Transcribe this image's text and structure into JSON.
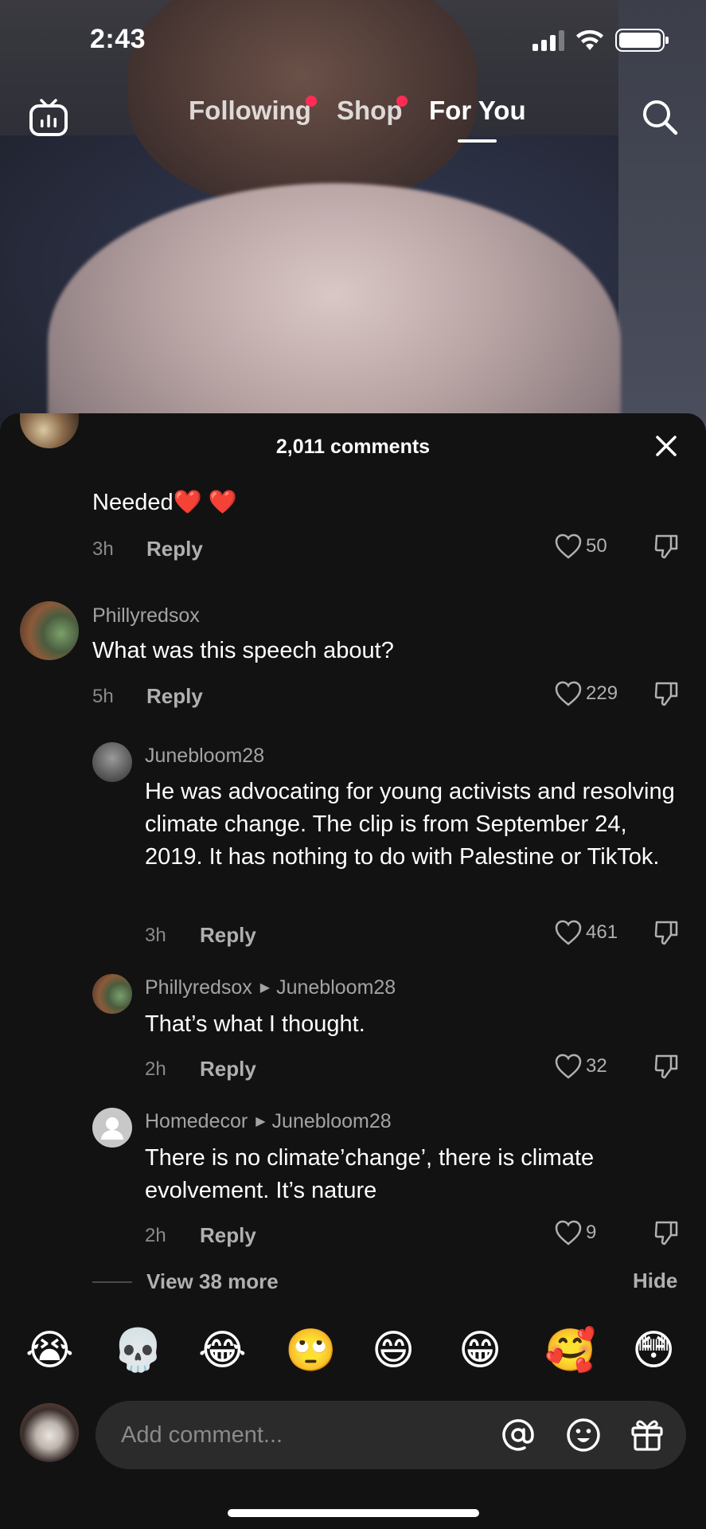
{
  "status_bar": {
    "time": "2:43",
    "icons": [
      "cellular-signal-icon",
      "wifi-icon",
      "battery-icon"
    ]
  },
  "top_nav": {
    "live_icon": "tv-live-icon",
    "tabs": [
      {
        "label": "Following",
        "badge_dot": true,
        "active": false
      },
      {
        "label": "Shop",
        "badge_dot": true,
        "active": false
      },
      {
        "label": "For You",
        "badge_dot": false,
        "active": true
      }
    ],
    "search_icon": "search-icon"
  },
  "comments_sheet": {
    "title": "2,011 comments",
    "close_icon": "close-icon",
    "comments": [
      {
        "username": "",
        "text": "Needed❤️ ❤️",
        "time": "3h",
        "reply_label": "Reply",
        "likes": "50",
        "reply_to": ""
      },
      {
        "username": "Phillyredsox",
        "text": "What was this speech about?",
        "time": "5h",
        "reply_label": "Reply",
        "likes": "229",
        "reply_to": ""
      },
      {
        "username": "Junebloom28",
        "text": "He was advocating for young activists and resolving climate change. The clip is from September 24, 2019. It has nothing to do with Palestine or TikTok.",
        "time": "3h",
        "reply_label": "Reply",
        "likes": "461",
        "reply_to": ""
      },
      {
        "username": "Phillyredsox",
        "text": "That’s what I thought.",
        "time": "2h",
        "reply_label": "Reply",
        "likes": "32",
        "reply_to": "Junebloom28"
      },
      {
        "username": "Homedecor",
        "text": "There is no climate’change’, there is climate evolvement. It’s nature",
        "time": "2h",
        "reply_label": "Reply",
        "likes": "9",
        "reply_to": "Junebloom28"
      }
    ],
    "view_more_label": "View 38 more",
    "hide_label": "Hide",
    "quick_emojis": [
      "😭",
      "💀",
      "😂",
      "🙄",
      "😄",
      "😁",
      "🥰",
      "😳"
    ],
    "composer": {
      "placeholder": "Add comment...",
      "icons": [
        "mention-icon",
        "emoji-icon",
        "gift-icon"
      ]
    }
  },
  "colors": {
    "sheet_bg": "#121212",
    "input_bg": "#2b2b2b",
    "badge_red": "#fe2c55",
    "secondary_text": "#a3a3a3"
  }
}
